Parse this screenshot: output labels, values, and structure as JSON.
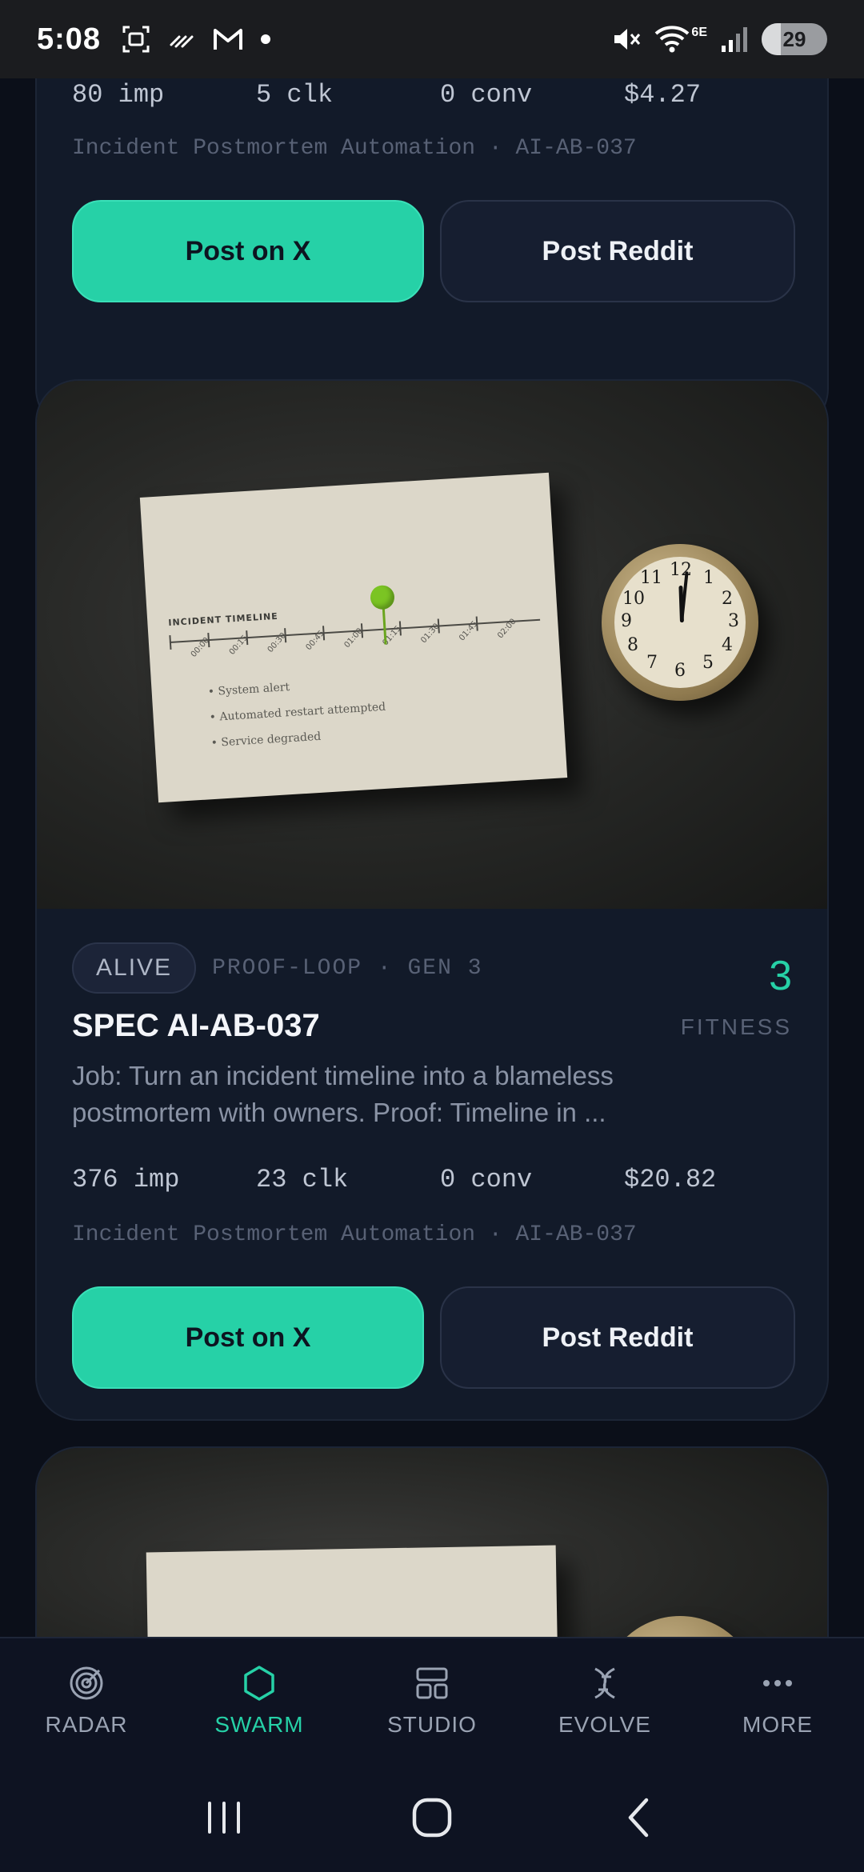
{
  "status_bar": {
    "time": "5:08",
    "network_label": "6E",
    "battery_percent": "29",
    "battery_level": 0.29
  },
  "cards": [
    {
      "stats": {
        "impressions": "80 imp",
        "clicks": "5 clk",
        "conversions": "0 conv",
        "spend": "$4.27"
      },
      "subtitle": "Incident Postmortem Automation · AI-AB-037",
      "primary_label": "Post on X",
      "secondary_label": "Post Reddit"
    },
    {
      "status": "ALIVE",
      "meta": "PROOF-LOOP · GEN 3",
      "fitness_value": "3",
      "fitness_label": "FITNESS",
      "title": "SPEC AI-AB-037",
      "description_line1": "Job: Turn an incident timeline into a blameless",
      "description_line2": "postmortem with owners. Proof: Timeline in ...",
      "stats": {
        "impressions": "376 imp",
        "clicks": "23 clk",
        "conversions": "0 conv",
        "spend": "$20.82"
      },
      "subtitle": "Incident Postmortem Automation · AI-AB-037",
      "primary_label": "Post on X",
      "secondary_label": "Post Reddit",
      "image": {
        "paper_title": "INCIDENT TIMELINE",
        "ticks": [
          "00:00",
          "00:15",
          "00:30",
          "00:45",
          "01:00",
          "01:15",
          "01:30",
          "01:45",
          "02:00"
        ],
        "notes": [
          "• System alert",
          "• Automated restart attempted",
          "• Service degraded"
        ],
        "clock_numbers": [
          "12",
          "1",
          "2",
          "3",
          "4",
          "5",
          "6",
          "7",
          "8",
          "9",
          "10",
          "11"
        ]
      }
    }
  ],
  "bottom_nav": [
    {
      "label": "RADAR",
      "icon": "radar-icon",
      "active": false
    },
    {
      "label": "SWARM",
      "icon": "hexagon-icon",
      "active": true
    },
    {
      "label": "STUDIO",
      "icon": "layout-icon",
      "active": false
    },
    {
      "label": "EVOLVE",
      "icon": "dna-icon",
      "active": false
    },
    {
      "label": "MORE",
      "icon": "more-icon",
      "active": false
    }
  ],
  "colors": {
    "accent": "#26d1a7",
    "background": "#0b0f19",
    "card": "#121a29"
  }
}
